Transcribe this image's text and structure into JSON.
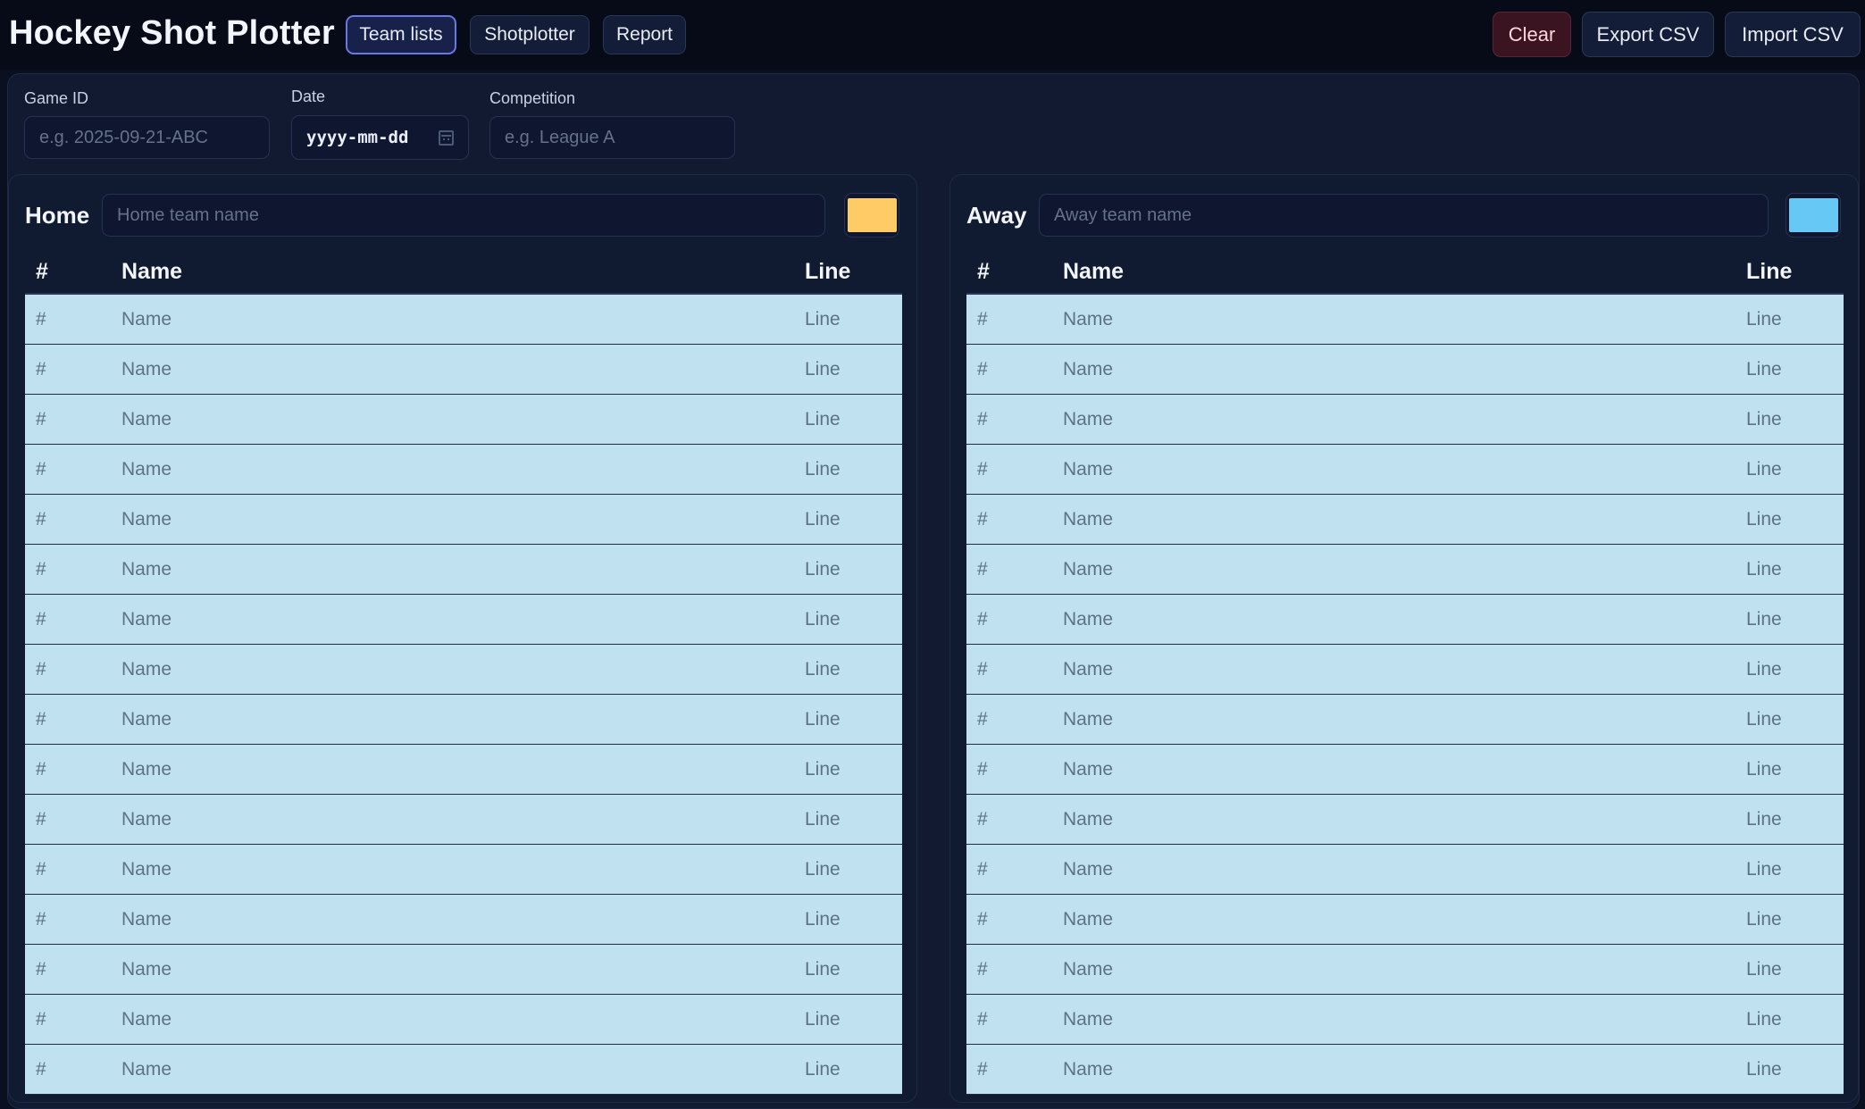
{
  "header": {
    "title": "Hockey Shot Plotter",
    "tabs": [
      {
        "label": "Team lists",
        "active": true
      },
      {
        "label": "Shotplotter",
        "active": false
      },
      {
        "label": "Report",
        "active": false
      }
    ],
    "actions": {
      "clear_label": "Clear",
      "export_label": "Export CSV",
      "import_label": "Import CSV"
    }
  },
  "game": {
    "game_id": {
      "label": "Game ID",
      "placeholder": "e.g. 2025-09-21-ABC",
      "value": ""
    },
    "date": {
      "label": "Date",
      "placeholder": "yyyy-mm-dd",
      "value": ""
    },
    "competition": {
      "label": "Competition",
      "placeholder": "e.g. League A",
      "value": ""
    }
  },
  "home": {
    "label": "Home",
    "name_placeholder": "Home team name",
    "color": "#ffcb66",
    "columns": {
      "number": "#",
      "name": "Name",
      "line": "Line"
    },
    "row_placeholder": {
      "number": "#",
      "name": "Name",
      "line": "Line"
    }
  },
  "away": {
    "label": "Away",
    "name_placeholder": "Away team name",
    "color": "#66c8f5",
    "columns": {
      "number": "#",
      "name": "Name",
      "line": "Line"
    },
    "row_placeholder": {
      "number": "#",
      "name": "Name",
      "line": "Line"
    }
  },
  "colors": {
    "background": "#0b1020",
    "panel": "#111a30",
    "roster_row": "#c0e1f0",
    "accent": "#6a78e6",
    "danger": "#3b1421"
  }
}
